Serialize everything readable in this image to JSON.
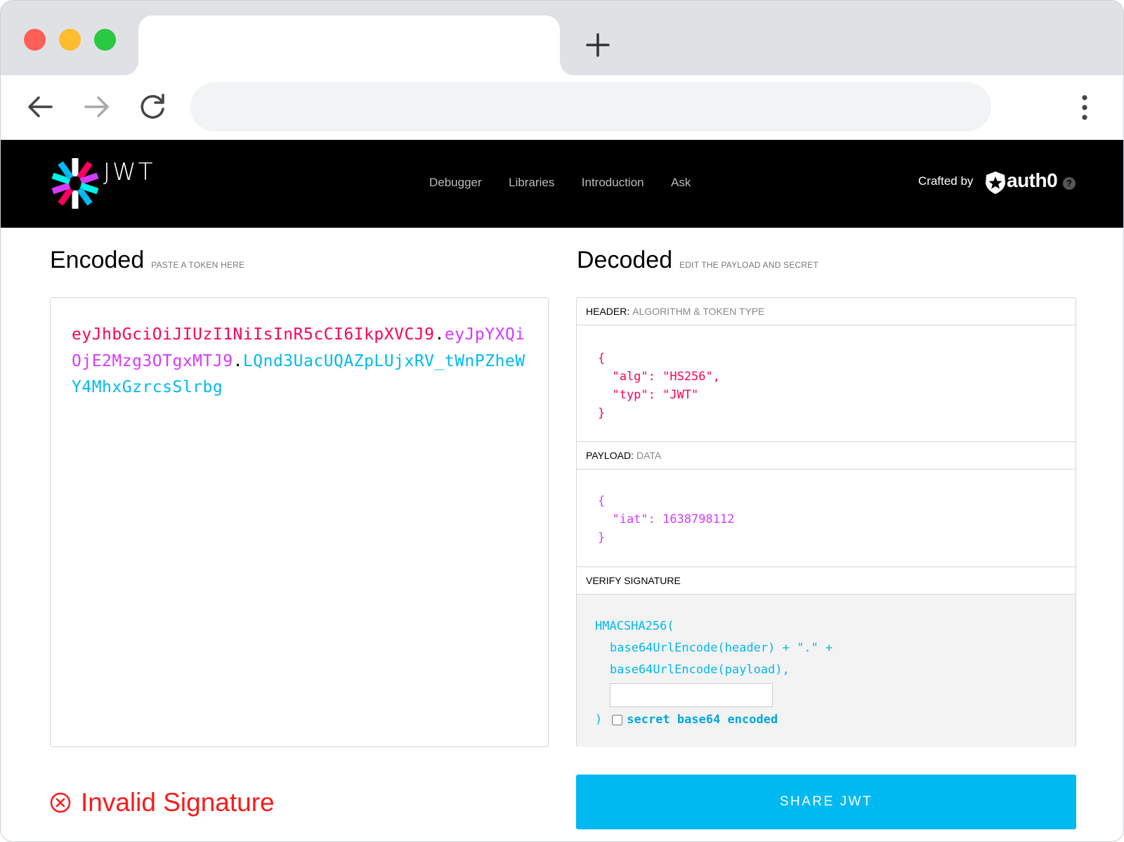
{
  "browser": {
    "address": {
      "value": "",
      "placeholder": ""
    },
    "new_tab_label": "+"
  },
  "header": {
    "logo_text": "JWT",
    "nav": [
      "Debugger",
      "Libraries",
      "Introduction",
      "Ask"
    ],
    "crafted_by": "Crafted by",
    "brand": "auth0",
    "help": "?"
  },
  "encoded": {
    "title": "Encoded",
    "hint": "PASTE A TOKEN HERE",
    "token_header": "eyJhbGciOiJIUzI1NiIsInR5cCI6IkpXVCJ9",
    "token_payload": "eyJpYXQiOjE2Mzg3OTgxMTJ9",
    "token_signature": "LQnd3UacUQAZpLUjxRV_tWnPZheWY4MhxGzrcsSlrbg",
    "dot": "."
  },
  "decoded": {
    "title": "Decoded",
    "hint": "EDIT THE PAYLOAD AND SECRET",
    "header_label": "HEADER:",
    "header_sub": "ALGORITHM & TOKEN TYPE",
    "header_json": [
      "{",
      "  \"alg\": \"HS256\",",
      "  \"typ\": \"JWT\"",
      "}"
    ],
    "payload_label": "PAYLOAD:",
    "payload_sub": "DATA",
    "payload_json": [
      "{",
      "  \"iat\": 1638798112",
      "}"
    ],
    "verify_label": "VERIFY SIGNATURE",
    "verify_fn": "HMACSHA256(",
    "verify_line1": "base64UrlEncode(header) + \".\" +",
    "verify_line2": "base64UrlEncode(payload),",
    "secret_value": "",
    "verify_close": ")",
    "secret_checkbox_label": "secret base64 encoded"
  },
  "status": {
    "text": "Invalid Signature"
  },
  "share_button": "SHARE JWT",
  "colors": {
    "header_part": "#fb015b",
    "payload_part": "#d63aff",
    "signature_part": "#00b9f1",
    "invalid": "#fb1b1b",
    "share_bg": "#00b9f1"
  }
}
